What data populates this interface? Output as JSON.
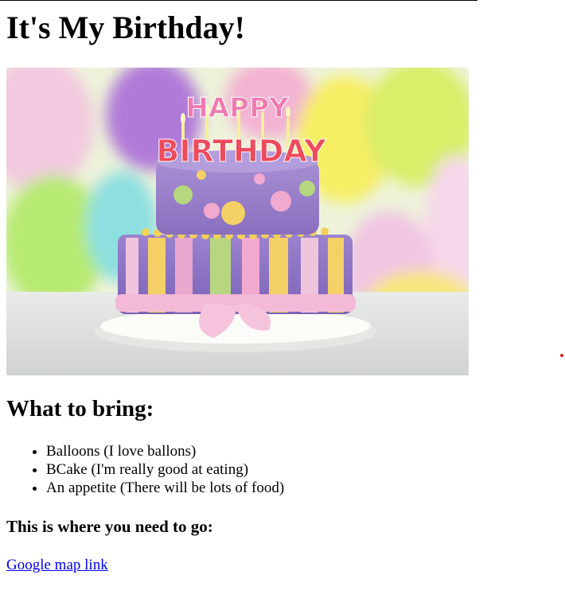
{
  "page": {
    "title": "It's My Birthday!",
    "hero_image": {
      "alt": "Birthday cake",
      "topper_line_1": "HAPPY",
      "topper_line_2": "BIRTHDAY"
    },
    "bring_heading": "What to bring:",
    "bring_items": [
      "Balloons (I love ballons)",
      "BCake (I'm really good at eating)",
      "An appetite (There will be lots of food)"
    ],
    "directions_heading": "This is where you need to go:",
    "map_link_text": "Google map link"
  },
  "colors": {
    "link": "#0000ee",
    "text": "#000000",
    "background": "#ffffff",
    "cursor_dot": "#e01818"
  }
}
